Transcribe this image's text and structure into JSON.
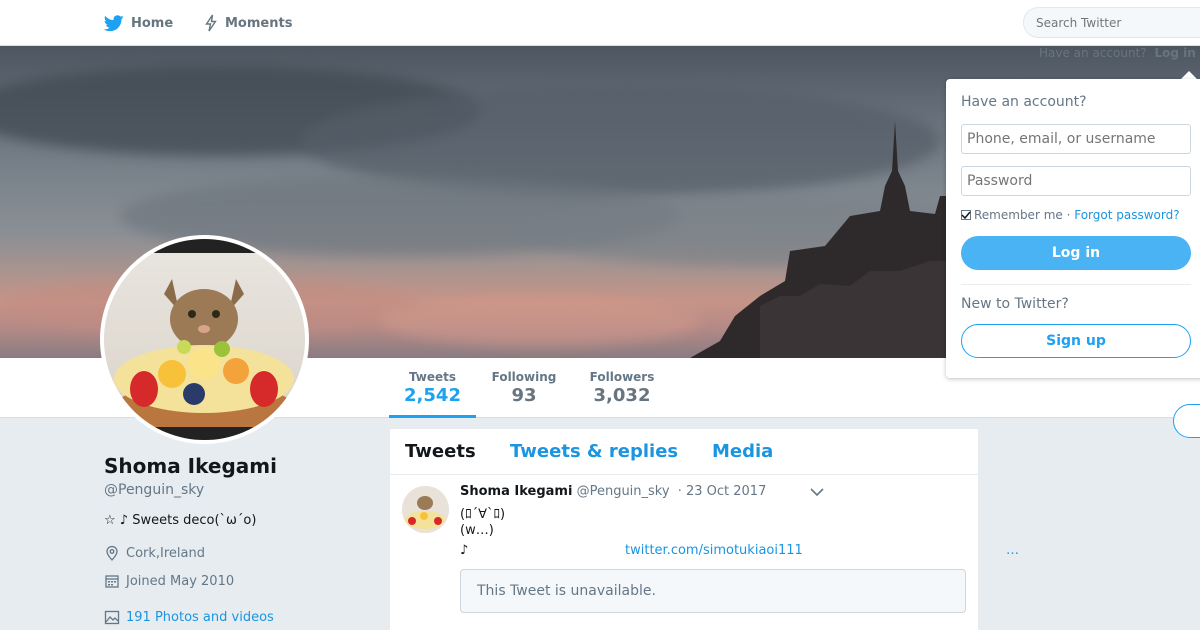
{
  "nav": {
    "home_label": "Home",
    "moments_label": "Moments",
    "search_placeholder": "Search Twitter",
    "have_account": "Have an account?",
    "login_link": "Log in"
  },
  "profile": {
    "name": "Shoma Ikegami",
    "handle": "@Penguin_sky",
    "bio": "☆ ♪ Sweets deco(`ω´o)",
    "location": "Cork,Ireland",
    "joined": "Joined May 2010",
    "photos": "191 Photos and videos"
  },
  "stats": [
    {
      "label": "Tweets",
      "value": "2,542"
    },
    {
      "label": "Following",
      "value": "93"
    },
    {
      "label": "Followers",
      "value": "3,032"
    }
  ],
  "tabs": [
    "Tweets",
    "Tweets & replies",
    "Media"
  ],
  "tweet": {
    "name": "Shoma Ikegami",
    "handle": "@Penguin_sky",
    "date": "· 23 Oct 2017",
    "line1": "(ﾛ´∀`ﾛ)",
    "line2": "(w…)",
    "line3": "♪",
    "link": "twitter.com/simotukiaoi111",
    "more": "…",
    "quote": "This Tweet is unavailable."
  },
  "login_popup": {
    "title": "Have an account?",
    "username_placeholder": "Phone, email, or username",
    "password_placeholder": "Password",
    "remember": "Remember me",
    "sep": " · ",
    "forgot": "Forgot password?",
    "login_button": "Log in",
    "new_label": "New to Twitter?",
    "signup_button": "Sign up"
  },
  "colors": {
    "accent": "#1da1f2",
    "login_button": "#4ab3f4",
    "background": "#e6ecf0"
  }
}
